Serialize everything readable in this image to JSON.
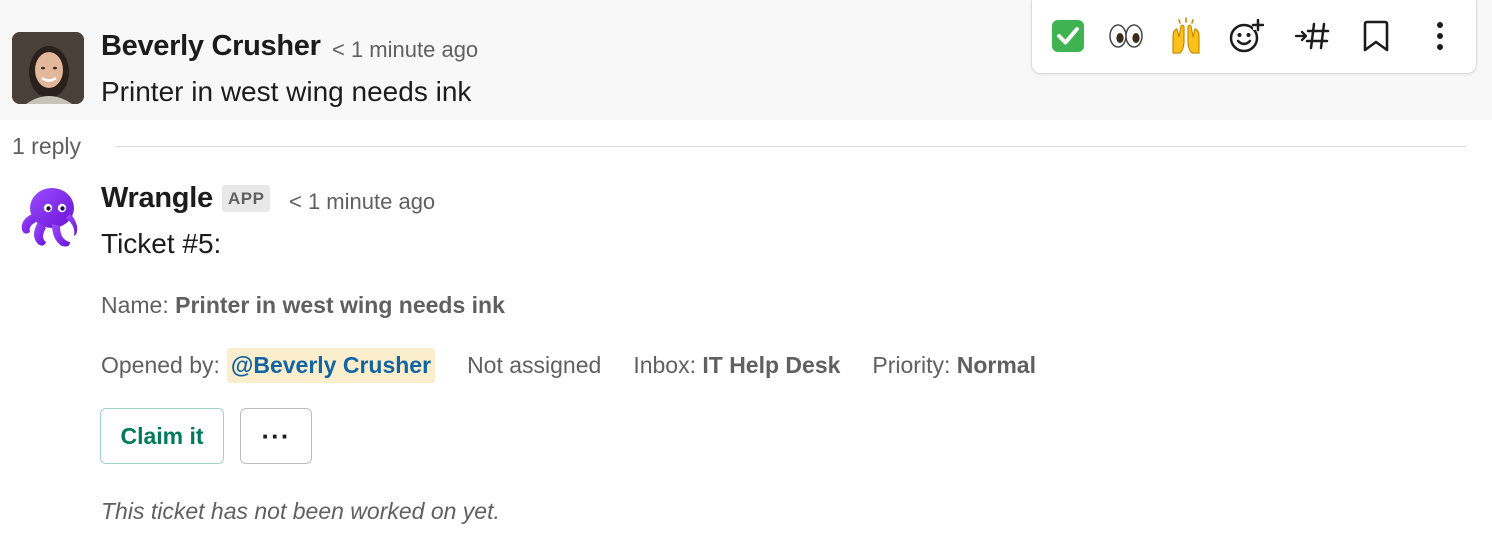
{
  "parent_message": {
    "author": "Beverly Crusher",
    "timestamp": "< 1 minute ago",
    "text": "Printer in west wing needs ink",
    "avatar": "user-photo"
  },
  "message_toolbar": {
    "actions": [
      {
        "name": "check-mark-reaction",
        "glyph": "✅"
      },
      {
        "name": "eyes-reaction",
        "glyph": "👀"
      },
      {
        "name": "raised-hands-reaction",
        "glyph": "🙌"
      },
      {
        "name": "add-reaction-icon"
      },
      {
        "name": "share-to-channel-icon"
      },
      {
        "name": "bookmark-icon"
      },
      {
        "name": "more-actions-icon"
      }
    ]
  },
  "thread": {
    "reply_count_label": "1 reply"
  },
  "reply": {
    "author": "Wrangle",
    "badge": "APP",
    "timestamp": "< 1 minute ago",
    "ticket_title": "Ticket #5:",
    "name_label": "Name:",
    "name_value": "Printer in west wing needs ink",
    "opened_by_label": "Opened by:",
    "opened_by_value": "@Beverly Crusher",
    "assignee": "Not assigned",
    "inbox_label": "Inbox:",
    "inbox_value": "IT Help Desk",
    "priority_label": "Priority:",
    "priority_value": "Normal",
    "claim_button": "Claim it",
    "more_button": "···",
    "status_note": "This ticket has not been worked on yet."
  },
  "colors": {
    "mention_bg": "#fbeecd",
    "mention_text": "#1264a3",
    "claim_green": "#007a5a",
    "app_purple": "#7b2ff7"
  }
}
